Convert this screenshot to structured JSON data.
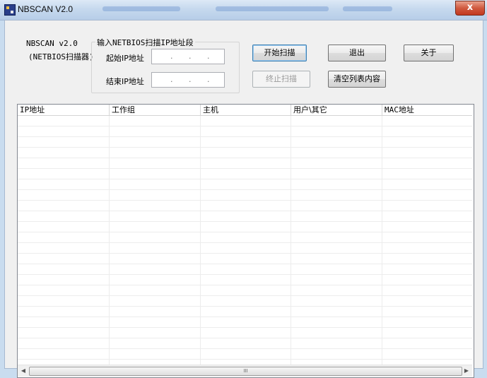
{
  "window": {
    "title": "NBSCAN V2.0",
    "close_glyph": "x"
  },
  "app": {
    "name_line1": "NBSCAN v2.0",
    "name_line2": "(NETBIOS扫描器)"
  },
  "ip_group": {
    "caption": "输入NETBIOS扫描IP地址段",
    "start_label": "起始IP地址",
    "end_label": "结束IP地址",
    "start_ip": [
      "",
      "",
      "",
      ""
    ],
    "end_ip": [
      "",
      "",
      "",
      ""
    ]
  },
  "buttons": {
    "start": "开始扫描",
    "exit": "退出",
    "about": "关于",
    "stop": "终止扫描",
    "clear": "清空列表内容"
  },
  "list": {
    "columns": [
      "IP地址",
      "工作组",
      "主机",
      "用户\\其它",
      "MAC地址"
    ],
    "rows": []
  },
  "scrollbar": {
    "thumb_glyph": "III",
    "left_arrow": "◀",
    "right_arrow": "▶"
  },
  "colors": {
    "titlebar": "#c6d9ee",
    "close_button": "#c2381f",
    "client_bg": "#f0f0f0"
  }
}
